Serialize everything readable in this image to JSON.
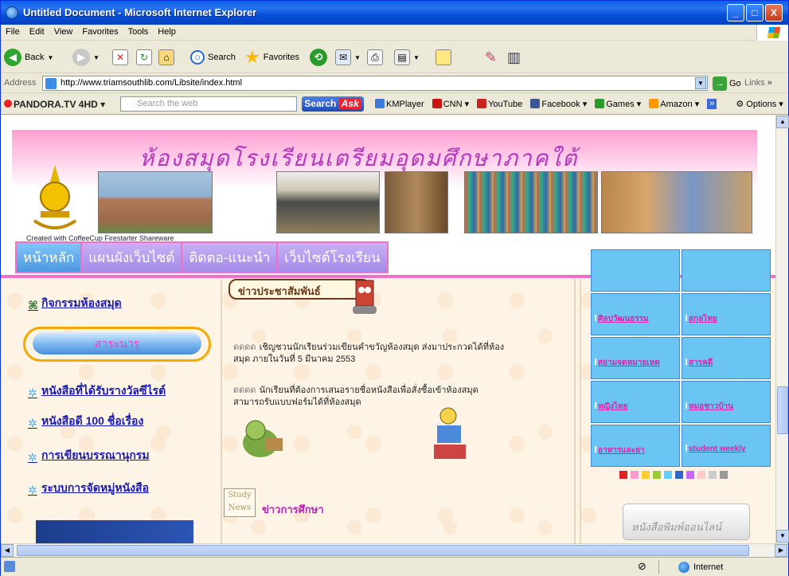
{
  "window": {
    "title": "Untitled Document - Microsoft Internet Explorer",
    "controls": {
      "minimize": "_",
      "maximize": "□",
      "close": "X"
    }
  },
  "menu": [
    "File",
    "Edit",
    "View",
    "Favorites",
    "Tools",
    "Help"
  ],
  "toolbar": {
    "back_label": "Back",
    "search_label": "Search",
    "favorites_label": "Favorites"
  },
  "address": {
    "label": "Address",
    "url": "http://www.triamsouthlib.com/Libsite/index.html",
    "go_label": "Go",
    "links_label": "Links"
  },
  "search_toolbar": {
    "brand": "PANDORA.TV 4HD",
    "placeholder": "Search the web",
    "button_label": "Search",
    "links": [
      {
        "label": "KMPlayer",
        "color": "#3a7ad8"
      },
      {
        "label": "CNN",
        "color": "#cc1111"
      },
      {
        "label": "YouTube",
        "color": "#cc2222"
      },
      {
        "label": "Facebook",
        "color": "#3b5998"
      },
      {
        "label": "Games",
        "color": "#2a9a2a"
      },
      {
        "label": "Amazon",
        "color": "#ff9900"
      }
    ],
    "options_label": "Options"
  },
  "page": {
    "banner_title": "ห้องสมุดโรงเรียนเตรียมอุดมศึกษาภาคใต้",
    "credit": "Created with CoffeeCup Firestarter Shareware",
    "nav_tabs": [
      "หน้าหลัก",
      "แผนผังเว็บไซต์",
      "ติดตอ-แนะนำ",
      "เว็บไซต์โรงเรียน"
    ],
    "left_links": [
      "กิจกรรมห้องสมุด",
      "หนังสือที่ได้รับรางวัลซีไรต์",
      "หนังสือดี 100 ชื่อเรื่อง",
      "การเขียนบรรณานุกรม",
      "ระบบการจัดหมู่หนังสือ"
    ],
    "highlight_button": "สาระนารู",
    "news_heading": "ข่าวประชาสัมพันธ์",
    "news_items": [
      "เชิญชวนนักเรียนร่วมเขียนคำขวัญห้องสมุด ส่งมาประกวดได้ที่ห้องสมุด ภายในวันที่ 5 มีนาคม 2553",
      "นักเรียนที่ต้องการเสนอรายชื่อหนังสือเพื่อสั่งซื้อเข้าห้องสมุด สามารถรับแบบฟอร์มได้ที่ห้องสมุด"
    ],
    "news_marker": "ดดดด",
    "study_icon": "Study News",
    "study_title": "ข่าวการศึกษา",
    "magazines": [
      "ศิลปวัฒนธรรม",
      "สกุลไทย",
      "สยามจดหมายเหตุ",
      "สารคดี",
      "หญิงไทย",
      "หมอชาวบ้าน",
      "อาหารและยา",
      "student weekly"
    ],
    "online_label": "หนังสือพิมพ์ออนไลน์"
  },
  "status": {
    "zone": "Internet"
  }
}
